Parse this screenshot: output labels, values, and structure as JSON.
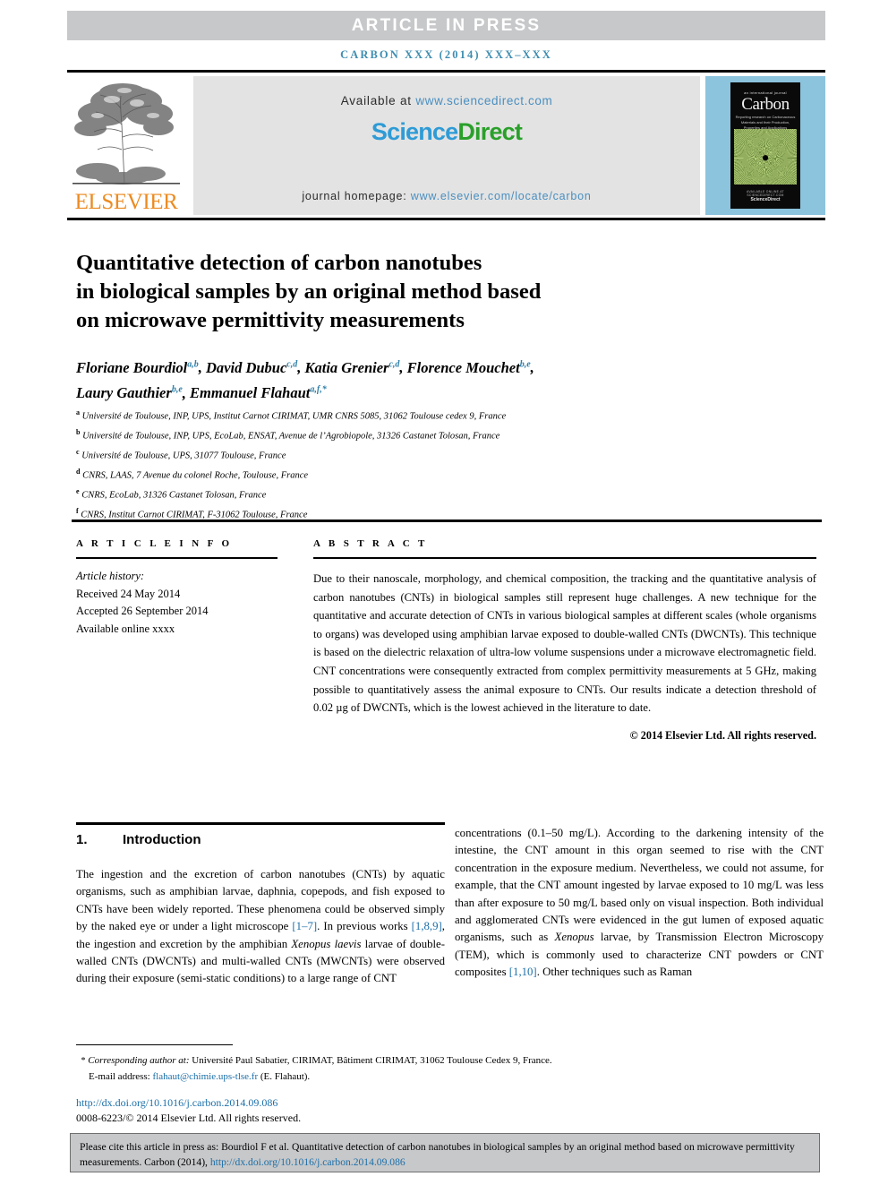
{
  "banner": {
    "article_in_press": "ARTICLE  IN  PRESS",
    "running_head": "CARBON XXX (2014) XXX–XXX"
  },
  "masthead": {
    "publisher": "ELSEVIER",
    "available_prefix": "Available at ",
    "available_url": "www.sciencedirect.com",
    "logo_part1": "Science",
    "logo_part2": "Direct",
    "homepage_prefix": "journal homepage: ",
    "homepage_url": "www.elsevier.com/locate/carbon",
    "cover": {
      "tagline": "an international journal",
      "journal": "Carbon",
      "subtitle": "Reporting research on Carbonaceous Materials and their Production, Properties and Applications",
      "footer_small": "AVAILABLE ONLINE AT SCIENCEDIRECT.COM",
      "footer_brand": "ScienceDirect"
    }
  },
  "article": {
    "title_line1": "Quantitative detection of carbon nanotubes",
    "title_line2": "in biological samples by an original method based",
    "title_line3": "on microwave permittivity measurements",
    "authors": [
      {
        "name": "Floriane Bourdiol",
        "sup": "a,b"
      },
      {
        "name": "David Dubuc",
        "sup": "c,d"
      },
      {
        "name": "Katia Grenier",
        "sup": "c,d"
      },
      {
        "name": "Florence Mouchet",
        "sup": "b,e"
      },
      {
        "name": "Laury Gauthier",
        "sup": "b,e"
      },
      {
        "name": "Emmanuel Flahaut",
        "sup": "a,f,*"
      }
    ],
    "affiliations": [
      {
        "mark": "a",
        "text": "Université de Toulouse, INP, UPS, Institut Carnot CIRIMAT, UMR CNRS 5085, 31062 Toulouse cedex 9, France"
      },
      {
        "mark": "b",
        "text": "Université de Toulouse, INP, UPS, EcoLab, ENSAT, Avenue de l’Agrobiopole, 31326 Castanet Tolosan, France"
      },
      {
        "mark": "c",
        "text": "Université de Toulouse, UPS, 31077 Toulouse, France"
      },
      {
        "mark": "d",
        "text": "CNRS, LAAS, 7 Avenue du colonel Roche, Toulouse, France"
      },
      {
        "mark": "e",
        "text": "CNRS, EcoLab, 31326 Castanet Tolosan, France"
      },
      {
        "mark": "f",
        "text": "CNRS, Institut Carnot CIRIMAT, F-31062 Toulouse, France"
      }
    ]
  },
  "article_info": {
    "heading": "A R T I C L E   I N F O",
    "history_label": "Article history:",
    "received": "Received 24 May 2014",
    "accepted": "Accepted 26 September 2014",
    "available": "Available online xxxx"
  },
  "abstract": {
    "heading": "A B S T R A C T",
    "text": "Due to their nanoscale, morphology, and chemical composition, the tracking and the quantitative analysis of carbon nanotubes (CNTs) in biological samples still represent huge challenges. A new technique for the quantitative and accurate detection of CNTs in various biological samples at different scales (whole organisms to organs) was developed using amphibian larvae exposed to double-walled CNTs (DWCNTs). This technique is based on the dielectric relaxation of ultra-low volume suspensions under a microwave electromagnetic field. CNT concentrations were consequently extracted from complex permittivity measurements at 5 GHz, making possible to quantitatively assess the animal exposure to CNTs. Our results indicate a detection threshold of 0.02 µg of DWCNTs, which is the lowest achieved in the literature to date.",
    "rights": "© 2014 Elsevier Ltd. All rights reserved."
  },
  "introduction": {
    "number": "1.",
    "heading": "Introduction",
    "left_p1_a": "The ingestion and the excretion of carbon nanotubes (CNTs) by aquatic organisms, such as amphibian larvae, daphnia, copepods, and fish exposed to CNTs have been widely reported. These phenomena could be observed simply by the naked eye or under a light microscope ",
    "left_ref1": "[1–7]",
    "left_p1_b": ". In previous works ",
    "left_ref2": "[1,8,9]",
    "left_p1_c": ", the ingestion and excretion by the amphibian ",
    "left_italic": "Xenopus laevis",
    "left_p1_d": " larvae of double-walled CNTs (DWCNTs) and multi-walled CNTs (MWCNTs) were observed during their exposure (semi-static conditions) to a large range of CNT",
    "right_p1_a": "concentrations (0.1–50 mg/L). According to the darkening intensity of the intestine, the CNT amount in this organ seemed to rise with the CNT concentration in the exposure medium. Nevertheless, we could not assume, for example, that the CNT amount ingested by larvae exposed to 10 mg/L was less than after exposure to 50 mg/L based only on visual inspection. Both individual and agglomerated CNTs were evidenced in the gut lumen of exposed aquatic organisms, such as ",
    "right_italic": "Xenopus",
    "right_p1_b": " larvae, by Transmission Electron Microscopy (TEM), which is commonly used to characterize CNT powders or CNT composites ",
    "right_ref1": "[1,10]",
    "right_p1_c": ". Other techniques such as Raman"
  },
  "footnotes": {
    "star": "*",
    "corresponding_label": "Corresponding author at:",
    "corresponding_text": " Université Paul Sabatier, CIRIMAT, Bâtiment CIRIMAT, 31062 Toulouse Cedex 9, France.",
    "email_label": "E-mail address:",
    "email": "flahaut@chimie.ups-tlse.fr",
    "email_suffix": " (E. Flahaut).",
    "doi": "http://dx.doi.org/10.1016/j.carbon.2014.09.086",
    "issn": "0008-6223/© 2014 Elsevier Ltd. All rights reserved."
  },
  "cite_box": {
    "text_a": "Please cite this article in press as: Bourdiol F et al. Quantitative detection of carbon nanotubes in biological samples by an original method based on microwave permittivity measurements. Carbon (2014), ",
    "link": "http://dx.doi.org/10.1016/j.carbon.2014.09.086"
  },
  "colors": {
    "band_gray": "#c7c8ca",
    "link_blue": "#1b6fa8",
    "running_head_blue": "#3f8db0",
    "elsevier_orange": "#ec8b21",
    "sciencedirect_blue": "#2e9bd6",
    "sciencedirect_green": "#2aa02a",
    "cover_blue": "#8cc3dd"
  }
}
